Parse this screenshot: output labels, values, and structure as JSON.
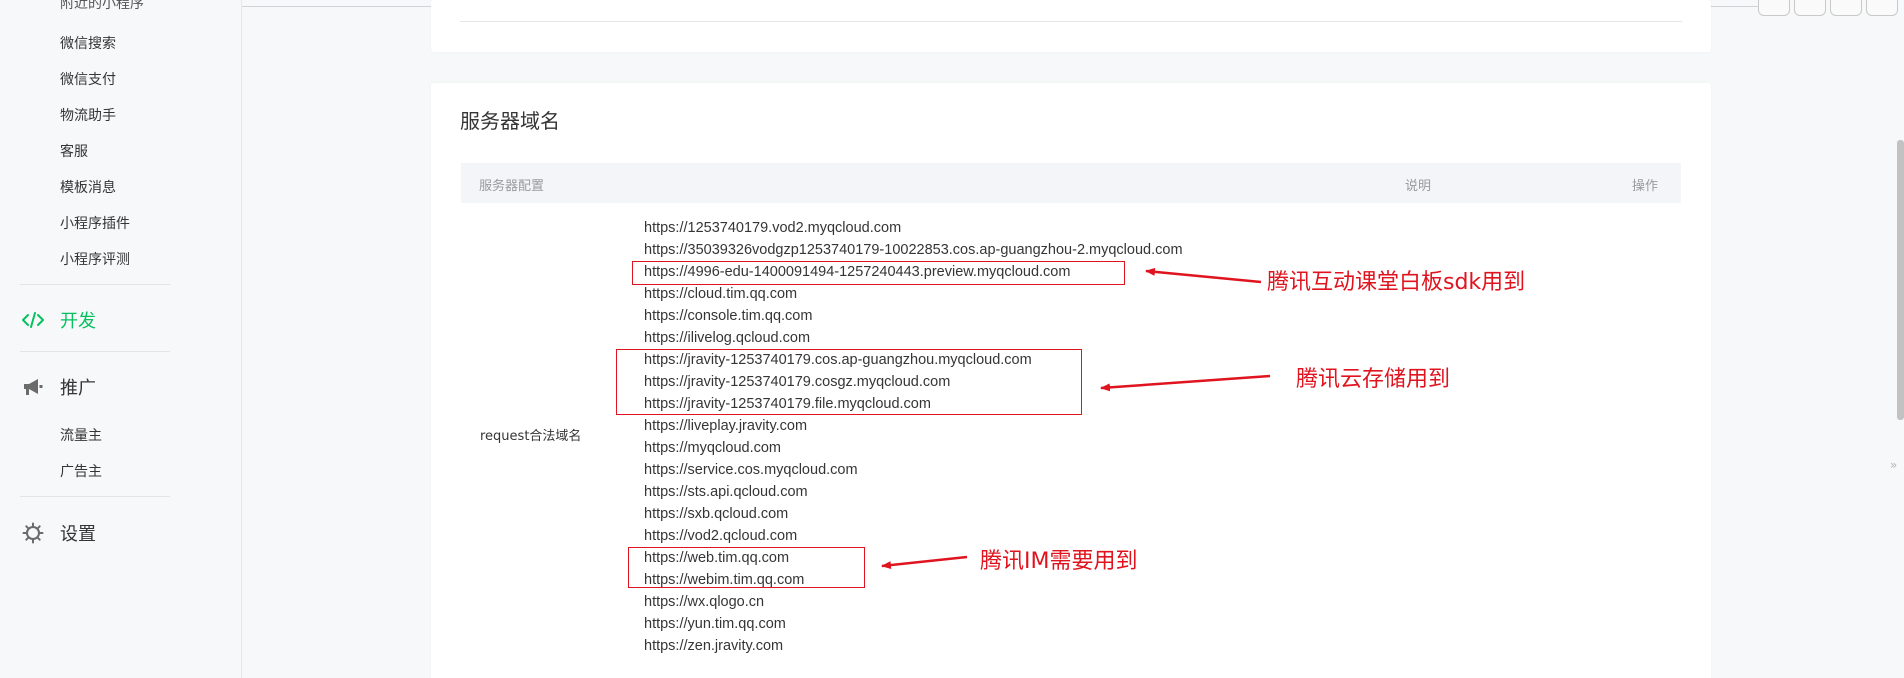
{
  "sidebar": {
    "cut_item": "附近的小程序",
    "sub_items": [
      "微信搜索",
      "微信支付",
      "物流助手",
      "客服",
      "模板消息",
      "小程序插件",
      "小程序评测"
    ],
    "dev_label": "开发",
    "promo_label": "推广",
    "promo_items": [
      "流量主",
      "广告主"
    ],
    "settings_label": "设置"
  },
  "server_domain": {
    "title": "服务器域名",
    "columns": {
      "config": "服务器配置",
      "desc": "说明",
      "ops": "操作"
    },
    "request_label": "request合法域名",
    "domains": [
      "https://1253740179.vod2.myqcloud.com",
      "https://35039326vodgzp1253740179-10022853.cos.ap-guangzhou-2.myqcloud.com",
      "https://4996-edu-1400091494-1257240443.preview.myqcloud.com",
      "https://cloud.tim.qq.com",
      "https://console.tim.qq.com",
      "https://ilivelog.qcloud.com",
      "https://jravity-1253740179.cos.ap-guangzhou.myqcloud.com",
      "https://jravity-1253740179.cosgz.myqcloud.com",
      "https://jravity-1253740179.file.myqcloud.com",
      "https://liveplay.jravity.com",
      "https://myqcloud.com",
      "https://service.cos.myqcloud.com",
      "https://sts.api.qcloud.com",
      "https://sxb.qcloud.com",
      "https://vod2.qcloud.com",
      "https://web.tim.qq.com",
      "https://webim.tim.qq.com",
      "https://wx.qlogo.cn",
      "https://yun.tim.qq.com",
      "https://zen.jravity.com"
    ]
  },
  "annotations": {
    "whiteboard": "腾讯互动课堂白板sdk用到",
    "cos": "腾讯云存储用到",
    "im": "腾讯IM需要用到"
  },
  "colors": {
    "accent_green": "#07c160",
    "annotation_red": "#e0141e",
    "page_bg": "#f6f8f9",
    "card_bg": "#ffffff"
  },
  "icons": {
    "dev": "code-icon",
    "promo": "megaphone-icon",
    "settings": "gear-icon"
  }
}
